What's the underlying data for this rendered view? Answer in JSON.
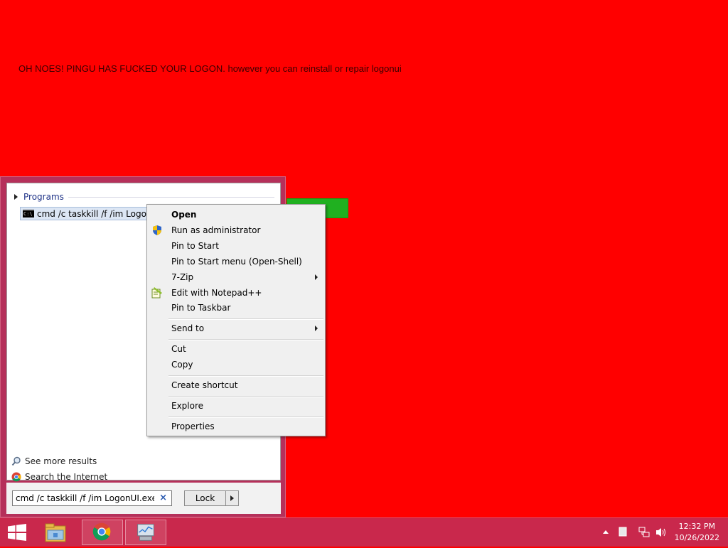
{
  "banner_text": "OH NOES! PINGU HAS FUCKED YOUR LOGON.  however you can reinstall or repair logonui",
  "start_menu": {
    "section_header": "Programs",
    "program_item": "cmd /c taskkill /f /im LogonUI.exe",
    "see_more": "See more results",
    "search_internet": "Search the Internet",
    "search_value": "cmd /c taskkill /f /im LogonUI.exe",
    "clear_symbol": "×",
    "power_button": "Lock"
  },
  "context_menu": {
    "open": "Open",
    "run_as_admin": "Run as administrator",
    "pin_start": "Pin to Start",
    "pin_start_menu": "Pin to Start menu (Open-Shell)",
    "seven_zip": "7-Zip",
    "edit_notepad": "Edit with Notepad++",
    "pin_taskbar": "Pin to Taskbar",
    "send_to": "Send to",
    "cut": "Cut",
    "copy": "Copy",
    "create_shortcut": "Create shortcut",
    "explore": "Explore",
    "properties": "Properties"
  },
  "taskbar": {
    "time": "12:32 PM",
    "date": "10/26/2022"
  },
  "colors": {
    "desktop": "#ff0000",
    "taskbar": "#c9284c",
    "start_frame": "#b5305a",
    "green_bar": "#20b020"
  },
  "icons": [
    "windows-logo-icon",
    "file-explorer-icon",
    "chrome-icon",
    "monitor-app-icon",
    "uac-shield-icon",
    "notepad-plus-icon",
    "search-icon",
    "cmd-icon",
    "tray-up-arrow-icon",
    "action-center-icon",
    "network-icon",
    "volume-icon"
  ]
}
